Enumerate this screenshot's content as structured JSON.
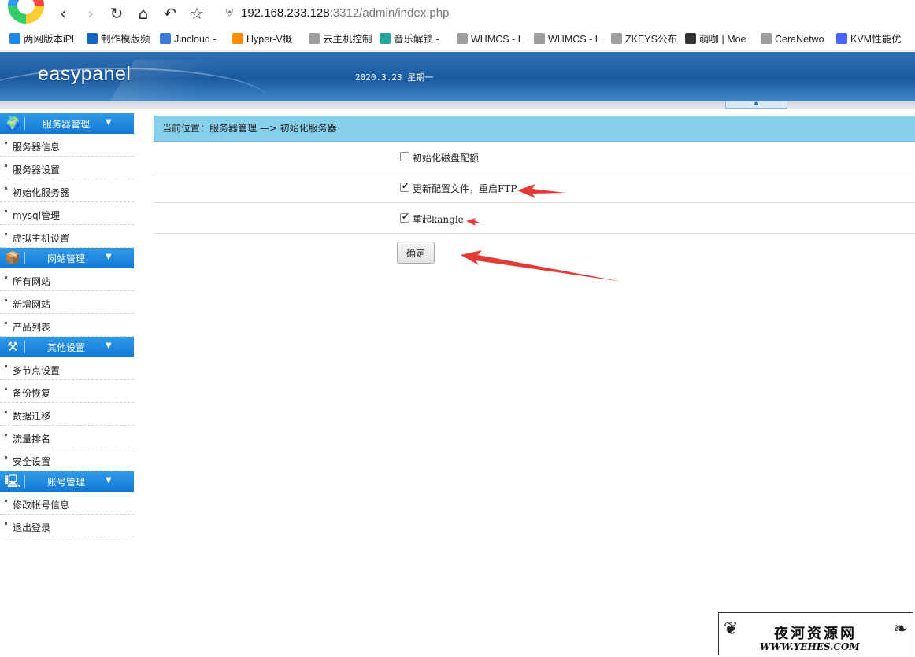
{
  "browser": {
    "address_host": "192.168.233.128",
    "address_rest": ":3312/admin/index.php",
    "bookmarks": [
      {
        "label": "两网版本iPl",
        "color": "#1e88e5"
      },
      {
        "label": "制作模版频",
        "color": "#1565c0"
      },
      {
        "label": "Jincloud -",
        "color": "#3d7bd6"
      },
      {
        "label": "Hyper-V概",
        "color": "#ff8a00"
      },
      {
        "label": "云主机控制",
        "color": "#9e9e9e"
      },
      {
        "label": "音乐解锁 -",
        "color": "#26a69a"
      },
      {
        "label": "WHMCS - L",
        "color": "#9e9e9e"
      },
      {
        "label": "WHMCS - L",
        "color": "#9e9e9e"
      },
      {
        "label": "ZKEYS公布",
        "color": "#9e9e9e"
      },
      {
        "label": "萌咖 | Moe",
        "color": "#333333"
      },
      {
        "label": "CeraNetwo",
        "color": "#9e9e9e"
      },
      {
        "label": "KVM性能优",
        "color": "#4a63ff"
      }
    ]
  },
  "header": {
    "brand": "easypanel",
    "date": "2020.3.23 星期一"
  },
  "sidebar": {
    "sections": [
      {
        "title": "服务器管理",
        "icon": "globe-icon",
        "items": [
          "服务器信息",
          "服务器设置",
          "初始化服务器",
          "mysql管理",
          "虚拟主机设置"
        ]
      },
      {
        "title": "网站管理",
        "icon": "box-icon",
        "items": [
          "所有网站",
          "新增网站",
          "产品列表"
        ]
      },
      {
        "title": "其他设置",
        "icon": "tools-icon",
        "items": [
          "多节点设置",
          "备份恢复",
          "数据迁移",
          "流量排名",
          "安全设置"
        ]
      },
      {
        "title": "账号管理",
        "icon": "computer-icon",
        "items": [
          "修改帐号信息",
          "退出登录"
        ]
      }
    ]
  },
  "main": {
    "breadcrumb": "当前位置：服务器管理 —> 初始化服务器",
    "options": [
      {
        "label": "初始化磁盘配额",
        "checked": false
      },
      {
        "label": "更新配置文件，重启FTP",
        "checked": true
      },
      {
        "label": "重起kangle",
        "checked": true
      }
    ],
    "confirm_label": "确定"
  },
  "watermark": {
    "title": "夜河资源网",
    "subtitle": "WWW.YEHES.COM"
  },
  "colors": {
    "header_blue": "#1a5aa0",
    "menu_head_blue": "#1179d6",
    "breadcrumb_bg": "#86d0ec",
    "annotation_red": "#e53935"
  }
}
